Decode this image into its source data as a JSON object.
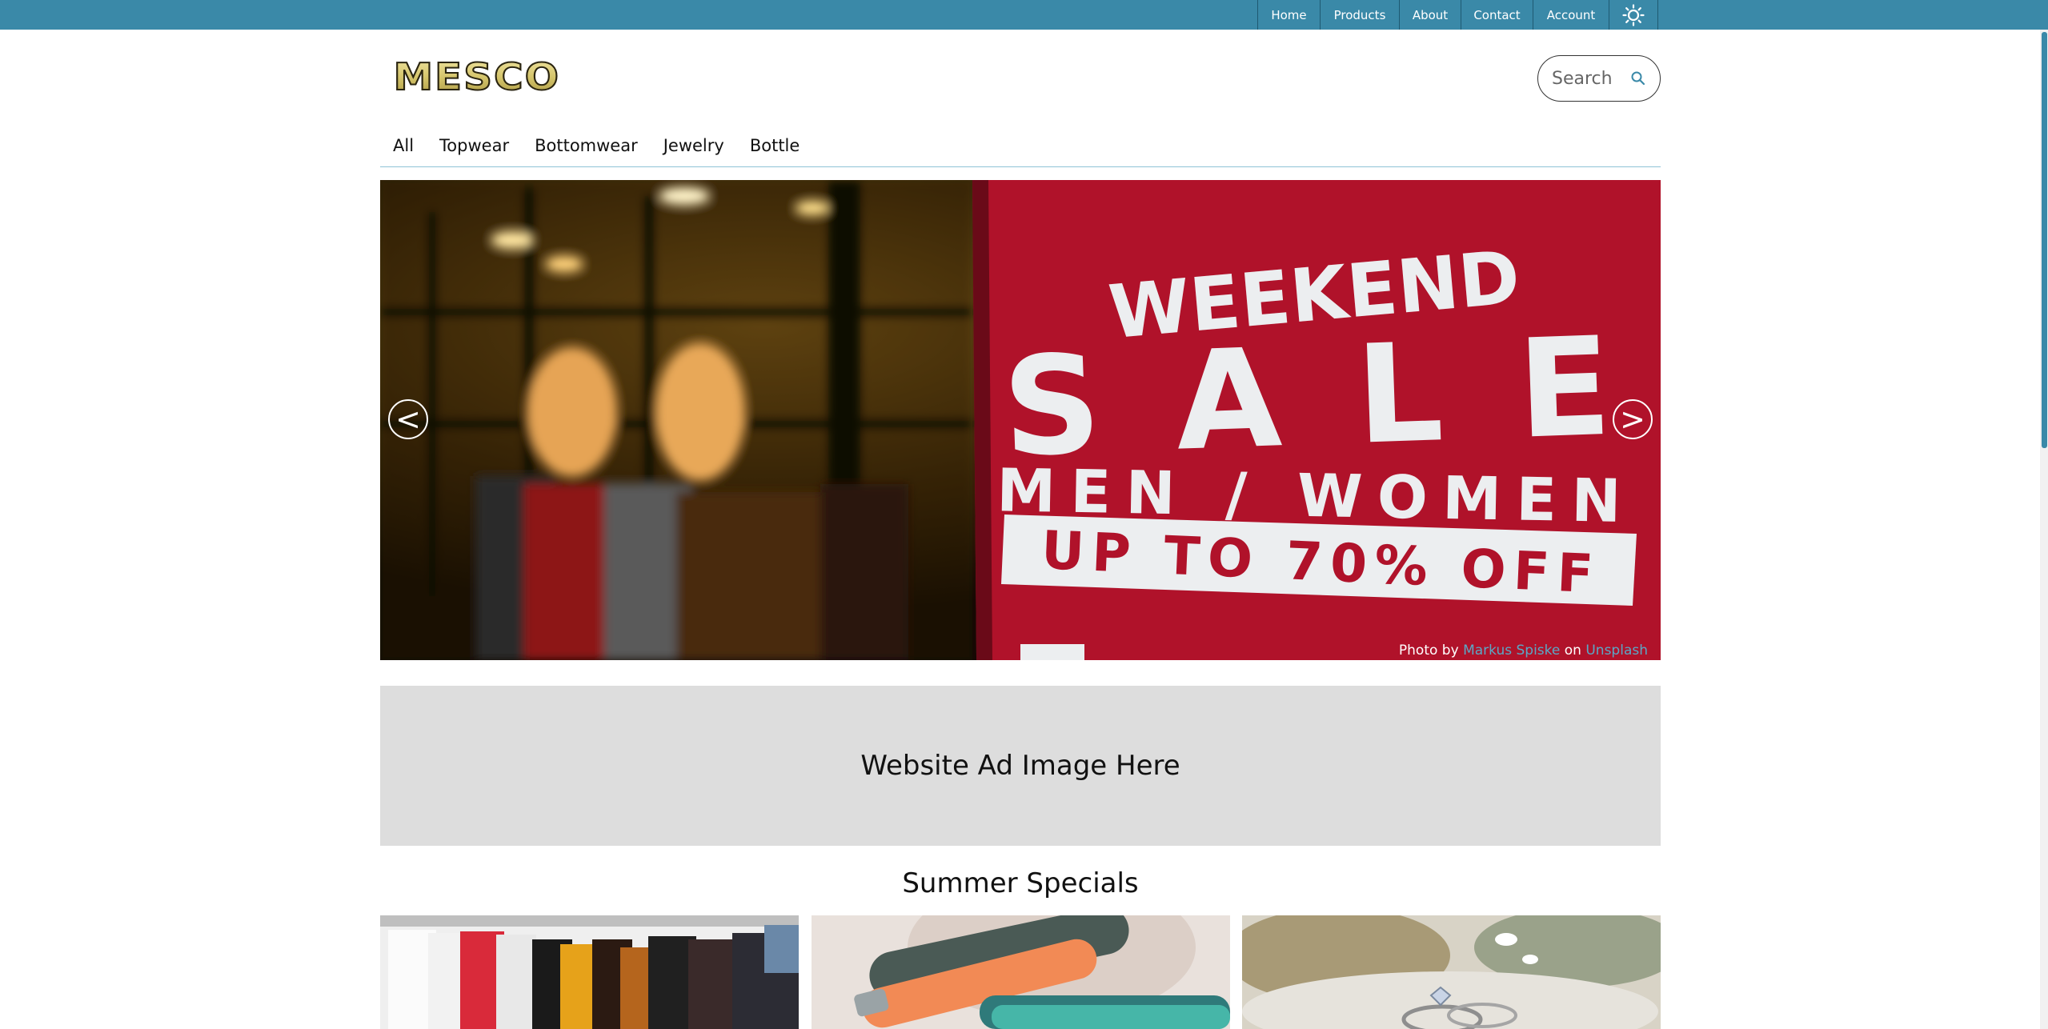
{
  "topnav": {
    "items": [
      "Home",
      "Products",
      "About",
      "Contact",
      "Account"
    ],
    "theme_toggle_icon": "sun-icon"
  },
  "brand": {
    "logo_text": "MESCO",
    "logo_color": "#d4c46a"
  },
  "search": {
    "placeholder": "Search",
    "icon": "search-icon"
  },
  "categories": [
    "All",
    "Topwear",
    "Bottomwear",
    "Jewelry",
    "Bottle"
  ],
  "hero": {
    "sign_lines": [
      "WEEKEND",
      "SALE",
      "MEN / WOMEN",
      "UP TO 70% OFF"
    ],
    "prev_label": "<",
    "next_label": ">",
    "credit_prefix": "Photo by",
    "credit_author": "Markus Spiske",
    "credit_mid": "on",
    "credit_site": "Unsplash"
  },
  "ad": {
    "text": "Website Ad Image Here"
  },
  "specials": {
    "title": "Summer Specials"
  },
  "colors": {
    "accent": "#3a89a8",
    "sale_red": "#b0122a",
    "ad_gray": "#dddddd"
  }
}
